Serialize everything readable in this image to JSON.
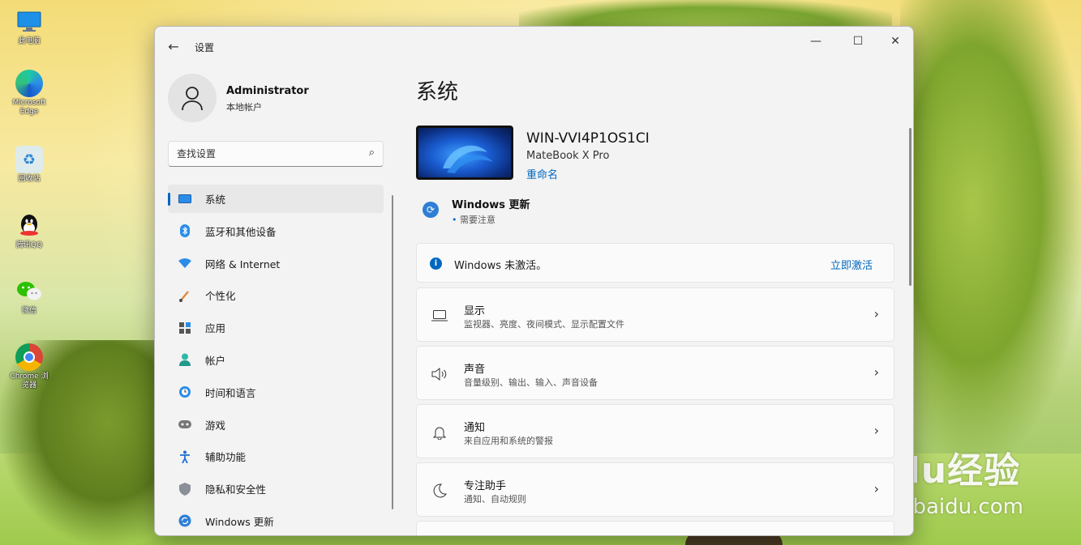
{
  "desktop": {
    "icons": [
      {
        "label": "此电脑",
        "icon": "computer-icon"
      },
      {
        "label": "Microsoft Edge",
        "icon": "edge-icon"
      },
      {
        "label": "回收站",
        "icon": "recycle-bin-icon"
      },
      {
        "label": "腾讯QQ",
        "icon": "qq-icon"
      },
      {
        "label": "微信",
        "icon": "wechat-icon"
      },
      {
        "label": "Chrome 浏览器",
        "icon": "chrome-icon"
      }
    ]
  },
  "watermark": {
    "main": "Baidu经验",
    "sub": "jingyan.baidu.com"
  },
  "window": {
    "title": "设置",
    "back_glyph": "←",
    "minimize_glyph": "—",
    "maximize_glyph": "☐",
    "close_glyph": "✕"
  },
  "profile": {
    "name": "Administrator",
    "account_type": "本地帐户"
  },
  "search": {
    "placeholder": "查找设置"
  },
  "sidebar": {
    "items": [
      {
        "label": "系统",
        "icon": "system-icon",
        "active": true
      },
      {
        "label": "蓝牙和其他设备",
        "icon": "bluetooth-icon"
      },
      {
        "label": "网络 & Internet",
        "icon": "network-icon"
      },
      {
        "label": "个性化",
        "icon": "personalization-icon"
      },
      {
        "label": "应用",
        "icon": "apps-icon"
      },
      {
        "label": "帐户",
        "icon": "accounts-icon"
      },
      {
        "label": "时间和语言",
        "icon": "time-language-icon"
      },
      {
        "label": "游戏",
        "icon": "gaming-icon"
      },
      {
        "label": "辅助功能",
        "icon": "accessibility-icon"
      },
      {
        "label": "隐私和安全性",
        "icon": "privacy-icon"
      },
      {
        "label": "Windows 更新",
        "icon": "windows-update-icon"
      }
    ]
  },
  "main": {
    "title": "系统",
    "device": {
      "name": "WIN-VVI4P1OS1CI",
      "model": "MateBook X Pro",
      "rename": "重命名"
    },
    "update": {
      "title": "Windows 更新",
      "status": "需要注意"
    },
    "activation": {
      "message": "Windows 未激活。",
      "action": "立即激活"
    },
    "settings": [
      {
        "title": "显示",
        "subtitle": "监视器、亮度、夜间模式、显示配置文件",
        "icon": "display-icon"
      },
      {
        "title": "声音",
        "subtitle": "音量级别、输出、输入、声音设备",
        "icon": "sound-icon"
      },
      {
        "title": "通知",
        "subtitle": "来自应用和系统的警报",
        "icon": "notifications-icon"
      },
      {
        "title": "专注助手",
        "subtitle": "通知、自动规则",
        "icon": "focus-assist-icon"
      }
    ]
  },
  "colors": {
    "accent": "#0067c0",
    "window_bg": "#f3f3f3",
    "card_bg": "#fbfbfb"
  }
}
